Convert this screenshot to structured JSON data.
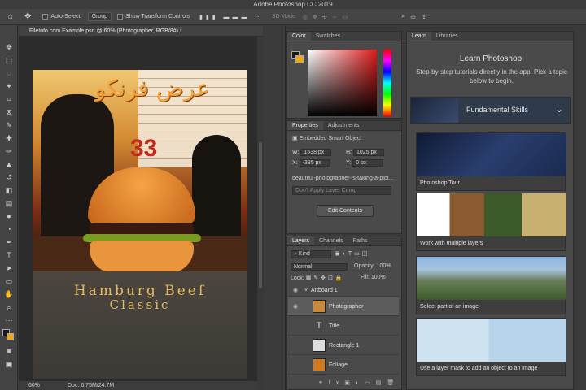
{
  "app_title": "Adobe Photoshop CC 2019",
  "options_bar": {
    "auto_select_label": "Auto-Select:",
    "auto_select_value": "Group",
    "show_transform_label": "Show Transform Controls",
    "mode_3d": "3D Mode:"
  },
  "document": {
    "tab_title": "FileInfo.com Example.psd @ 60% (Photographer, RGB/8#) *",
    "arabic_text": "عرض فرنكو",
    "jersey_number": "33",
    "headline_line1": "Hamburg Beef",
    "headline_line2": "Classic"
  },
  "status_bar": {
    "zoom": "60%",
    "doc_size": "Doc: 6.75M/24.7M"
  },
  "color_panel": {
    "tabs": [
      "Color",
      "Swatches"
    ],
    "fg_color": "#1a1a1a",
    "bg_color": "#f3a71a"
  },
  "properties_panel": {
    "tabs": [
      "Properties",
      "Adjustments"
    ],
    "object_type": "Embedded Smart Object",
    "w_label": "W:",
    "w": "1538 px",
    "h_label": "H:",
    "h": "1025 px",
    "x_label": "X:",
    "x": "-385 px",
    "y_label": "Y:",
    "y": "0 px",
    "filename": "beautiful-photographer-is-taking-a-pict...",
    "layer_comp": "Don't Apply Layer Comp",
    "edit_button": "Edit Contents"
  },
  "layers_panel": {
    "tabs": [
      "Layers",
      "Channels",
      "Paths"
    ],
    "filter": "Kind",
    "blend_mode": "Normal",
    "opacity_label": "Opacity:",
    "opacity": "100%",
    "lock_label": "Lock:",
    "fill_label": "Fill:",
    "fill": "100%",
    "layers": [
      {
        "name": "Artboard 1"
      },
      {
        "name": "Photographer"
      },
      {
        "name": "Title"
      },
      {
        "name": "Rectangle 1"
      },
      {
        "name": "Foliage"
      }
    ]
  },
  "learn_panel": {
    "tabs": [
      "Learn",
      "Libraries"
    ],
    "heading": "Learn Photoshop",
    "description": "Step-by-step tutorials directly in the app. Pick a topic below to begin.",
    "section": "Fundamental Skills",
    "tutorials": [
      {
        "label": "Photoshop Tour"
      },
      {
        "label": "Work with multiple layers"
      },
      {
        "label": "Select part of an image"
      },
      {
        "label": "Use a layer mask to add an object to an image"
      }
    ]
  }
}
